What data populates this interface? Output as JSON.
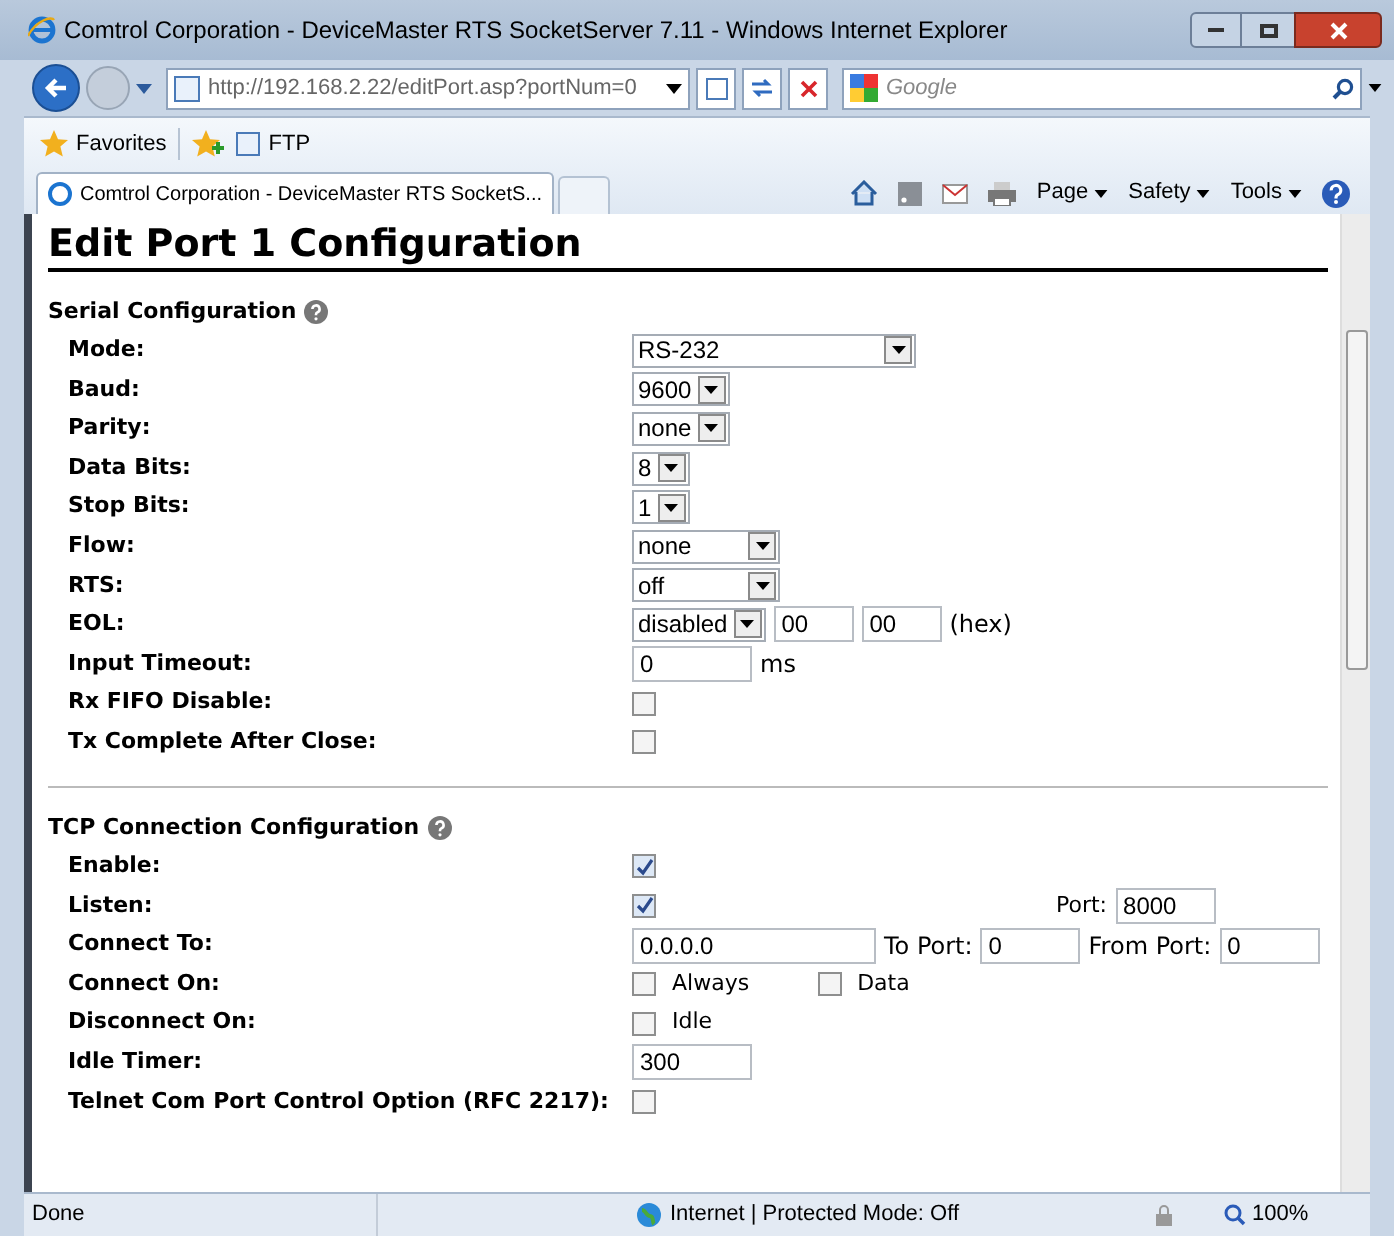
{
  "window": {
    "title": "Comtrol Corporation - DeviceMaster RTS SocketServer 7.11 - Windows Internet Explorer"
  },
  "address_bar": {
    "value": "http://192.168.2.22/editPort.asp?portNum=0"
  },
  "search": {
    "placeholder": "Google"
  },
  "favorites_bar": {
    "favorites": "Favorites",
    "items": [
      "FTP"
    ]
  },
  "tabs": [
    {
      "label": "Comtrol Corporation - DeviceMaster RTS SocketS...",
      "selected": true
    }
  ],
  "command_bar": [
    "Page",
    "Safety",
    "Tools"
  ],
  "page": {
    "heading": "Edit Port 1 Configuration",
    "sections": [
      {
        "title": "Serial Configuration",
        "rows": [
          {
            "label": "Mode:",
            "controls": [
              {
                "kind": "wide_select",
                "value": "RS-232"
              }
            ]
          },
          {
            "label": "Baud:",
            "controls": [
              {
                "kind": "select",
                "value": "9600"
              }
            ]
          },
          {
            "label": "Parity:",
            "controls": [
              {
                "kind": "select",
                "value": "none"
              }
            ]
          },
          {
            "label": "Data Bits:",
            "controls": [
              {
                "kind": "select",
                "value": "8"
              }
            ]
          },
          {
            "label": "Stop Bits:",
            "controls": [
              {
                "kind": "select",
                "value": "1"
              }
            ]
          },
          {
            "label": "Flow:",
            "controls": [
              {
                "kind": "medium_select",
                "value": "none"
              }
            ]
          },
          {
            "label": "RTS:",
            "controls": [
              {
                "kind": "medium_select",
                "value": "off"
              }
            ]
          },
          {
            "label": "EOL:",
            "controls": [
              {
                "kind": "select",
                "value": "disabled"
              },
              {
                "kind": "short_input",
                "value": "00"
              },
              {
                "kind": "short_input",
                "value": "00"
              },
              {
                "kind": "text",
                "text": "(hex)"
              }
            ]
          },
          {
            "label": "Input Timeout:",
            "controls": [
              {
                "kind": "input",
                "value": "0"
              },
              {
                "kind": "text",
                "text": "ms"
              }
            ]
          },
          {
            "label": "Rx FIFO Disable:",
            "controls": [
              {
                "kind": "checkbox",
                "checked": false
              }
            ]
          },
          {
            "label": "Tx Complete After Close:",
            "controls": [
              {
                "kind": "checkbox",
                "checked": false
              }
            ]
          }
        ]
      },
      {
        "title": "TCP Connection Configuration",
        "rows": [
          {
            "label": "Enable:",
            "controls": [
              {
                "kind": "checkbox",
                "checked": true
              }
            ]
          },
          {
            "label": "Listen:",
            "controls": [
              {
                "kind": "checkbox",
                "checked": true
              },
              {
                "kind": "far_text",
                "text": "Port:"
              },
              {
                "kind": "port_input",
                "value": "8000"
              }
            ]
          },
          {
            "label": "Connect To:",
            "controls": [
              {
                "kind": "wide_input",
                "value": "0.0.0.0"
              },
              {
                "kind": "text",
                "text": "To Port:"
              },
              {
                "kind": "port_input",
                "value": "0"
              },
              {
                "kind": "text",
                "text": "From Port:"
              },
              {
                "kind": "port_input",
                "value": "0"
              }
            ]
          },
          {
            "label": "Connect On:",
            "controls": [
              {
                "kind": "checkbox",
                "checked": false,
                "text": "Always"
              },
              {
                "kind": "checkbox",
                "checked": false,
                "text": "Data"
              }
            ]
          },
          {
            "label": "Disconnect On:",
            "controls": [
              {
                "kind": "checkbox",
                "checked": false,
                "text": "Idle"
              }
            ]
          },
          {
            "label": "Idle Timer:",
            "controls": [
              {
                "kind": "input",
                "value": "300"
              }
            ]
          },
          {
            "label": "Telnet Com Port Control Option (RFC 2217):",
            "controls": [
              {
                "kind": "checkbox",
                "checked": false
              }
            ]
          }
        ]
      }
    ]
  },
  "status_bar": {
    "text": "Done",
    "zone": "Internet | Protected Mode: Off",
    "zoom": "100%"
  }
}
